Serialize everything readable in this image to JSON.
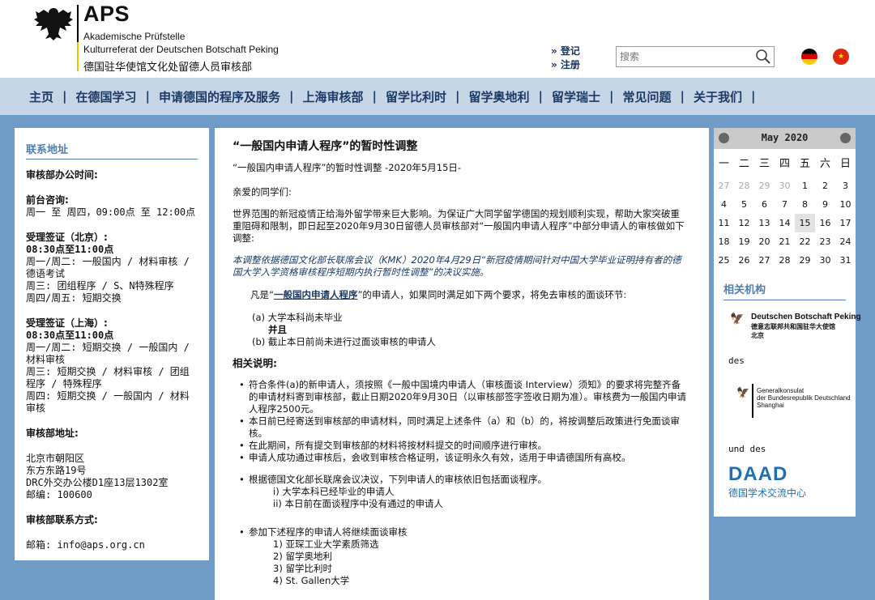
{
  "brand": {
    "title": "APS",
    "line1": "Akademische Prüfstelle",
    "line2": "Kulturreferat der Deutschen Botschaft Peking",
    "line3": "德国驻华使馆文化处留德人员审核部"
  },
  "top": {
    "login": "» 登记",
    "register": "» 注册",
    "search_placeholder": "搜索"
  },
  "nav": [
    "主页",
    "在德国学习",
    "申请德国的程序及服务",
    "上海审核部",
    "留学比利时",
    "留学奥地利",
    "留学瑞士",
    "常见问题",
    "关于我们"
  ],
  "left": {
    "heading": "联系地址",
    "office_hours": "审核部办公时间:",
    "front_label": "前台咨询:",
    "front_text": "周一 至 周四，09:00点 至 12:00点",
    "visa_bj_label": "受理签证（北京）:",
    "visa_bj_time": "08:30点至11:00点",
    "visa_bj_lines": [
      "周一/周二: 一般国内 / 材料审核 /",
      "德语考试",
      "周三: 团组程序 / S、N特殊程序",
      "周四/周五: 短期交换"
    ],
    "visa_sh_label": "受理签证（上海）:",
    "visa_sh_time": "08:30点至11:00点",
    "visa_sh_lines": [
      "周一/周二: 短期交换 / 一般国内 /",
      "材料审核",
      "周三: 短期交换 / 材料审核 / 团组",
      "程序 / 特殊程序",
      "周四: 短期交换 / 一般国内 / 材料",
      "审核"
    ],
    "addr_label": "审核部地址:",
    "addr_lines": [
      "北京市朝阳区",
      "东方东路19号",
      "DRC外交办公楼D1座13层1302室",
      "邮编: 100600"
    ],
    "contact_label": "审核部联系方式:",
    "email": "邮箱: info@aps.org.cn"
  },
  "main": {
    "title": "“一般国内申请人程序”的暂时性调整",
    "subtitle": "“一般国内申请人程序”的暂时性调整 -2020年5月15日-",
    "greeting": "亲爱的同学们:",
    "intro": "世界范围的新冠疫情正给海外留学带来巨大影响。为保证广大同学留学德国的规划顺利实现，帮助大家突破重重阻碍和限制，即日起至2020年9月30日留德人员审核部对“一般国内申请人程序”中部分申请人的审核做如下调整:",
    "italic": "本调整依据德国文化部长联席会议（KMK）2020年4月29日“新冠疫情期间针对中国大学毕业证明持有者的德国大学入学资格审核程序短期内执行暂时性调整”的决议实施。",
    "cond_pre": "凡是“",
    "cond_link": "一般国内申请人程序",
    "cond_post": "”的申请人，如果同时满足如下两个要求，将免去审核的面谈环节:",
    "cond_a": "(a) 大学本科尚未毕业",
    "cond_and": "并且",
    "cond_b": "(b) 截止本日前尚未进行过面谈审核的申请人",
    "notes_label": "相关说明:",
    "n1": "符合条件(a)的新申请人，须按照《一般中国境内申请人（审核面谈 Interview）须知》的要求将完整齐备的申请材料寄到审核部，截止日期2020年9月30日（以审核部签字签收日期为准）。审核费为一般国内申请人程序2500元。",
    "n2": "本日前已经寄送到审核部的申请材料，同时满足上述条件（a）和（b）的，将按调整后政策进行免面谈审核。",
    "n3": "在此期间，所有提交到审核部的材料将按材料提交的时间顺序进行审核。",
    "n4": "申请人成功通过审核后，会收到审核合格证明，该证明永久有效，适用于申请德国所有高校。",
    "n5": "根据德国文化部长联席会议决议，下列申请人的审核依旧包括面谈程序。",
    "n5_i": "i) 大学本科已经毕业的申请人",
    "n5_ii": "ii) 本日前在面谈程序中没有通过的申请人",
    "n6": "参加下述程序的申请人将继续面谈审核",
    "n6_list": [
      "1) 亚琛工业大学素质筛选",
      "2) 留学奥地利",
      "3) 留学比利时",
      "4) St. Gallen大学"
    ]
  },
  "calendar": {
    "title": "May 2020",
    "weekdays": [
      "一",
      "二",
      "三",
      "四",
      "五",
      "六",
      "日"
    ],
    "days": [
      "27",
      "28",
      "29",
      "30",
      "1",
      "2",
      "3",
      "4",
      "5",
      "6",
      "7",
      "8",
      "9",
      "10",
      "11",
      "12",
      "13",
      "14",
      "15",
      "16",
      "17",
      "18",
      "19",
      "20",
      "21",
      "22",
      "23",
      "24",
      "25",
      "26",
      "27",
      "28",
      "29",
      "30",
      "31"
    ],
    "today": "15"
  },
  "related": {
    "heading": "相关机构",
    "embassy_en": "Deutschen Botschaft Peking",
    "embassy_cn": "德意志联邦共和国驻华大使馆",
    "embassy_city": "北京",
    "des": "des",
    "consulate_1": "Generalkonsulat",
    "consulate_2": "der Bundesrepublik Deutschland",
    "consulate_3": "Shanghai",
    "und_des": "und des",
    "daad": "DAAD",
    "daad_cn": "德国学术交流中心"
  },
  "colors": {
    "accent": "#4f7fb5",
    "nav_bg": "#c7d6e6",
    "page_bg": "#6f9cc7"
  }
}
